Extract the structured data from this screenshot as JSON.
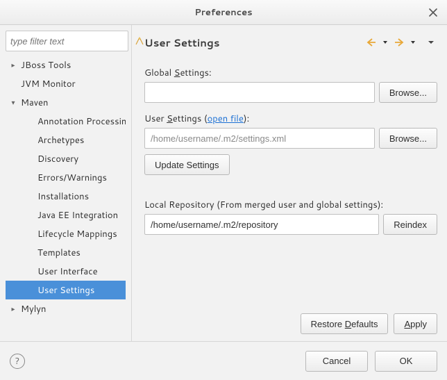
{
  "window": {
    "title": "Preferences"
  },
  "filter": {
    "placeholder": "type filter text"
  },
  "tree": {
    "jboss": "JBoss Tools",
    "jvm": "JVM Monitor",
    "maven": "Maven",
    "maven_children": {
      "annotation": "Annotation Processing",
      "archetypes": "Archetypes",
      "discovery": "Discovery",
      "errors": "Errors/Warnings",
      "installations": "Installations",
      "javaee": "Java EE Integration",
      "lifecycle": "Lifecycle Mappings",
      "templates": "Templates",
      "ui": "User Interface",
      "usersettings": "User Settings"
    },
    "mylyn": "Mylyn"
  },
  "page": {
    "title": "User Settings",
    "global_label_pre": "Global ",
    "global_label_u": "S",
    "global_label_post": "ettings:",
    "global_value": "",
    "user_label_pre": "User ",
    "user_label_u": "S",
    "user_label_post": "ettings (",
    "open_file": "open file",
    "user_label_close": "):",
    "user_value": "/home/username/.m2/settings.xml",
    "update_btn": "Update Settings",
    "local_repo_label": "Local Repository (From merged user and global settings):",
    "local_repo_value": "/home/username/.m2/repository",
    "browse": "Browse...",
    "reindex": "Reindex",
    "restore_pre": "Restore ",
    "restore_u": "D",
    "restore_post": "efaults",
    "apply_u": "A",
    "apply_post": "pply"
  },
  "footer": {
    "cancel": "Cancel",
    "ok": "OK"
  }
}
